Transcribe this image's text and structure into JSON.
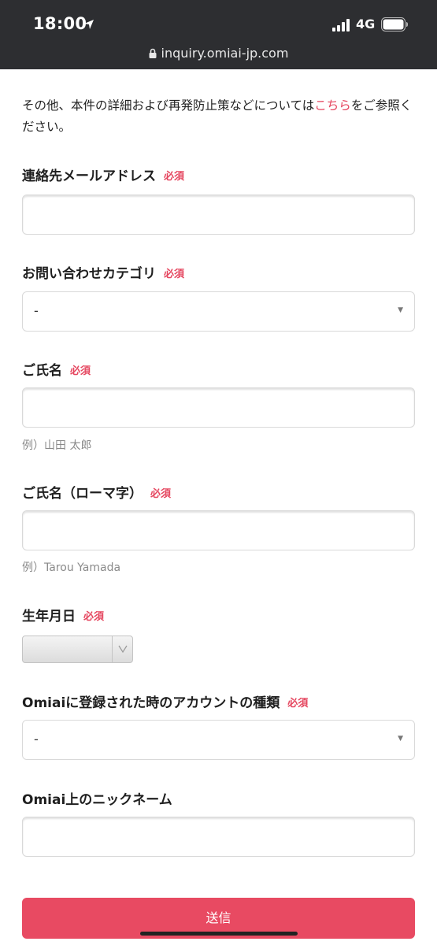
{
  "status": {
    "time": "18:00",
    "network": "4G"
  },
  "browser": {
    "url": "inquiry.omiai-jp.com"
  },
  "intro": {
    "text_before": "その他、本件の詳細および再発防止策などについては",
    "link": "こちら",
    "text_after": "をご参照ください。"
  },
  "required_label": "必須",
  "fields": {
    "email": {
      "label": "連絡先メールアドレス",
      "value": ""
    },
    "category": {
      "label": "お問い合わせカテゴリ",
      "value": "-"
    },
    "name": {
      "label": "ご氏名",
      "value": "",
      "hint": "例）山田 太郎"
    },
    "name_roman": {
      "label": "ご氏名（ローマ字）",
      "value": "",
      "hint": "例）Tarou Yamada"
    },
    "birthdate": {
      "label": "生年月日"
    },
    "account_type": {
      "label": "Omiaiに登録された時のアカウントの種類",
      "value": "-"
    },
    "nickname": {
      "label": "Omiai上のニックネーム",
      "value": ""
    }
  },
  "submit_label": "送信",
  "icons": [
    "location-arrow-icon",
    "signal-icon",
    "battery-icon",
    "lock-icon",
    "chevron-down-icon"
  ]
}
